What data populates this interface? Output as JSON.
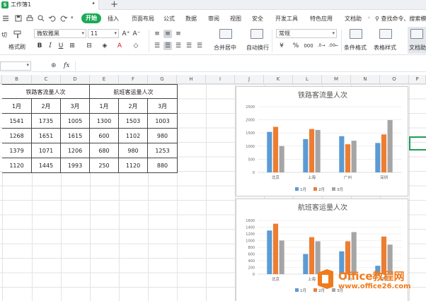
{
  "window": {
    "doc_tab": "工作簿1",
    "logo_letter": "S"
  },
  "menu": {
    "items": [
      "开始",
      "插入",
      "页面布局",
      "公式",
      "数据",
      "审阅",
      "视图",
      "安全",
      "开发工具",
      "特色应用",
      "文档助"
    ],
    "search": "查找命令、搜索模"
  },
  "ribbon": {
    "cut": "切",
    "format_painter": "格式刷",
    "font_name": "微软雅黑",
    "font_size": "11",
    "merge_center": "合并居中",
    "wrap_text": "自动换行",
    "number_format": "常规",
    "percent": "%",
    "thousands": "000",
    "cond_format": "条件格式",
    "table_style": "表格样式",
    "doc_helper": "文档助"
  },
  "formula_bar": {
    "fx": "fx"
  },
  "columns": [
    "B",
    "C",
    "D",
    "E",
    "F",
    "G",
    "H",
    "I",
    "J",
    "K",
    "L",
    "M",
    "N",
    "O",
    "P"
  ],
  "table": {
    "group1": "铁路客流量人次",
    "group2": "航班客运量人次",
    "months": [
      "1月",
      "2月",
      "3月",
      "1月",
      "2月",
      "3月"
    ],
    "rows": [
      [
        "1541",
        "1735",
        "1005",
        "1300",
        "1503",
        "1003"
      ],
      [
        "1268",
        "1651",
        "1615",
        "600",
        "1102",
        "980"
      ],
      [
        "1379",
        "1071",
        "1206",
        "680",
        "980",
        "1253"
      ],
      [
        "1120",
        "1445",
        "1993",
        "250",
        "1120",
        "880"
      ]
    ]
  },
  "chart_data": [
    {
      "type": "bar",
      "title": "铁路客流量人次",
      "categories": [
        "北京",
        "上海",
        "广州",
        "深圳"
      ],
      "series": [
        {
          "name": "1月",
          "values": [
            1541,
            1268,
            1379,
            1120
          ]
        },
        {
          "name": "2月",
          "values": [
            1735,
            1651,
            1071,
            1445
          ]
        },
        {
          "name": "3月",
          "values": [
            1005,
            1615,
            1206,
            1993
          ]
        }
      ],
      "ylim": [
        0,
        2500
      ],
      "yticks": [
        0,
        500,
        1000,
        1500,
        2000,
        2500
      ],
      "legend": "bottom",
      "colors": [
        "#5b9bd5",
        "#ed7d31",
        "#a5a5a5"
      ]
    },
    {
      "type": "bar",
      "title": "航班客运量人次",
      "categories": [
        "北京",
        "上海",
        "广州",
        "深圳"
      ],
      "series": [
        {
          "name": "1月",
          "values": [
            1300,
            600,
            680,
            250
          ]
        },
        {
          "name": "2月",
          "values": [
            1503,
            1102,
            980,
            1120
          ]
        },
        {
          "name": "3月",
          "values": [
            1003,
            980,
            1253,
            880
          ]
        }
      ],
      "ylim": [
        0,
        1600
      ],
      "yticks": [
        0,
        200,
        400,
        600,
        800,
        1000,
        1200,
        1400,
        1600
      ],
      "legend": "bottom",
      "colors": [
        "#5b9bd5",
        "#ed7d31",
        "#a5a5a5"
      ]
    }
  ],
  "watermark": {
    "title": "Office教程网",
    "url": "www.office26.com"
  }
}
